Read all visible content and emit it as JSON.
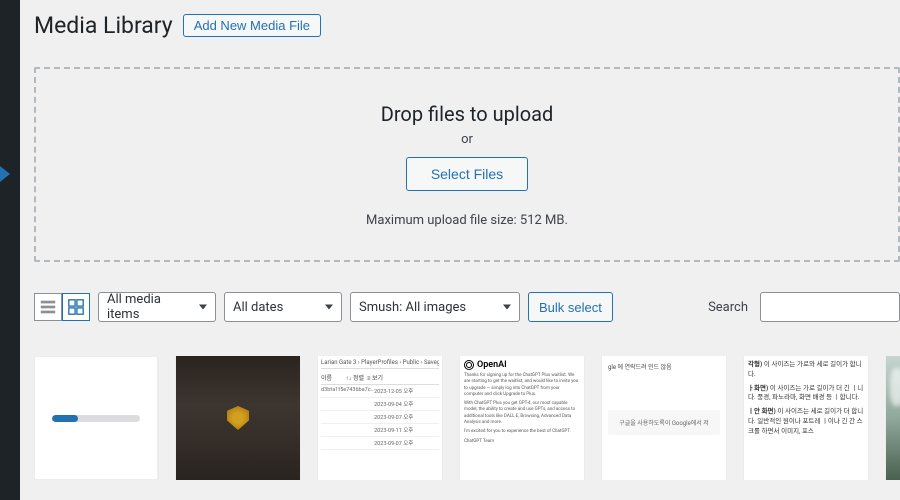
{
  "header": {
    "page_title": "Media Library",
    "add_new_label": "Add New Media File"
  },
  "uploader": {
    "drop_title": "Drop files to upload",
    "or_text": "or",
    "select_files_label": "Select Files",
    "max_size_text": "Maximum upload file size: 512 MB."
  },
  "toolbar": {
    "filter_media_type": "All media items",
    "filter_dates": "All dates",
    "filter_smush": "Smush: All images",
    "bulk_select_label": "Bulk select",
    "search_label": "Search"
  },
  "media_items": [
    {
      "kind": "uploading",
      "progress_percent": 30
    },
    {
      "kind": "game-screenshot"
    },
    {
      "kind": "file-table",
      "breadcrumb": "Larian Gate 3 › PlayerProfiles › Public › Saveg",
      "rows": [
        {
          "name": "d3bfa1f5e7436ba7c...",
          "date": "2023-12-05 오후",
          "size": ""
        },
        {
          "name": "",
          "date": "2023-09-04 오후",
          "size": ""
        },
        {
          "name": "",
          "date": "2023-09-07 오후",
          "size": ""
        },
        {
          "name": "",
          "date": "2023-09-11 오후",
          "size": ""
        },
        {
          "name": "",
          "date": "2023-09-07 오후",
          "size": ""
        }
      ]
    },
    {
      "kind": "openai-email",
      "logo_text": "OpenAI",
      "para1": "Thanks for signing up for the ChatGPT Plus waitlist. We are starting to get the waitlist, and would like to invite you to upgrade — simply log into ChatGPT from your computer and click Upgrade to Plus.",
      "para2": "With ChatGPT Plus you get GPT-4, our most capable model, the ability to create and use GPTs, and access to additional tools like DALL·E, Browsing, Advanced Data Analysis and more.",
      "para3": "I'm excited for you to experience the best of ChatGPT.",
      "sign": "ChatGPT Team"
    },
    {
      "kind": "korean-card",
      "title_line": "gle 에 연락드려 민드 않음",
      "block_text": "구글을 사용하도록이 Google에서 저"
    },
    {
      "kind": "korean-sizes",
      "line1_label": "각형)",
      "line1_text": "이 사이즈는 가로와 세로 길이가 합니다.",
      "line2_label": "ㅏ화면)",
      "line2_text": "이 사이즈는 가로 길이가 더 긴 ㅣ니다. 풍경, 파노라마, 화면 배경 등 ㅣ합니다.",
      "line3_label": "ㅣ안 화면)",
      "line3_text": "이 사이즈는 세로 길이가 더 합니다. 일반적인 원이나 포트레 ㅣ이나 긴 간 스크롤 하면서 이미지, 포스"
    },
    {
      "kind": "nature"
    }
  ]
}
